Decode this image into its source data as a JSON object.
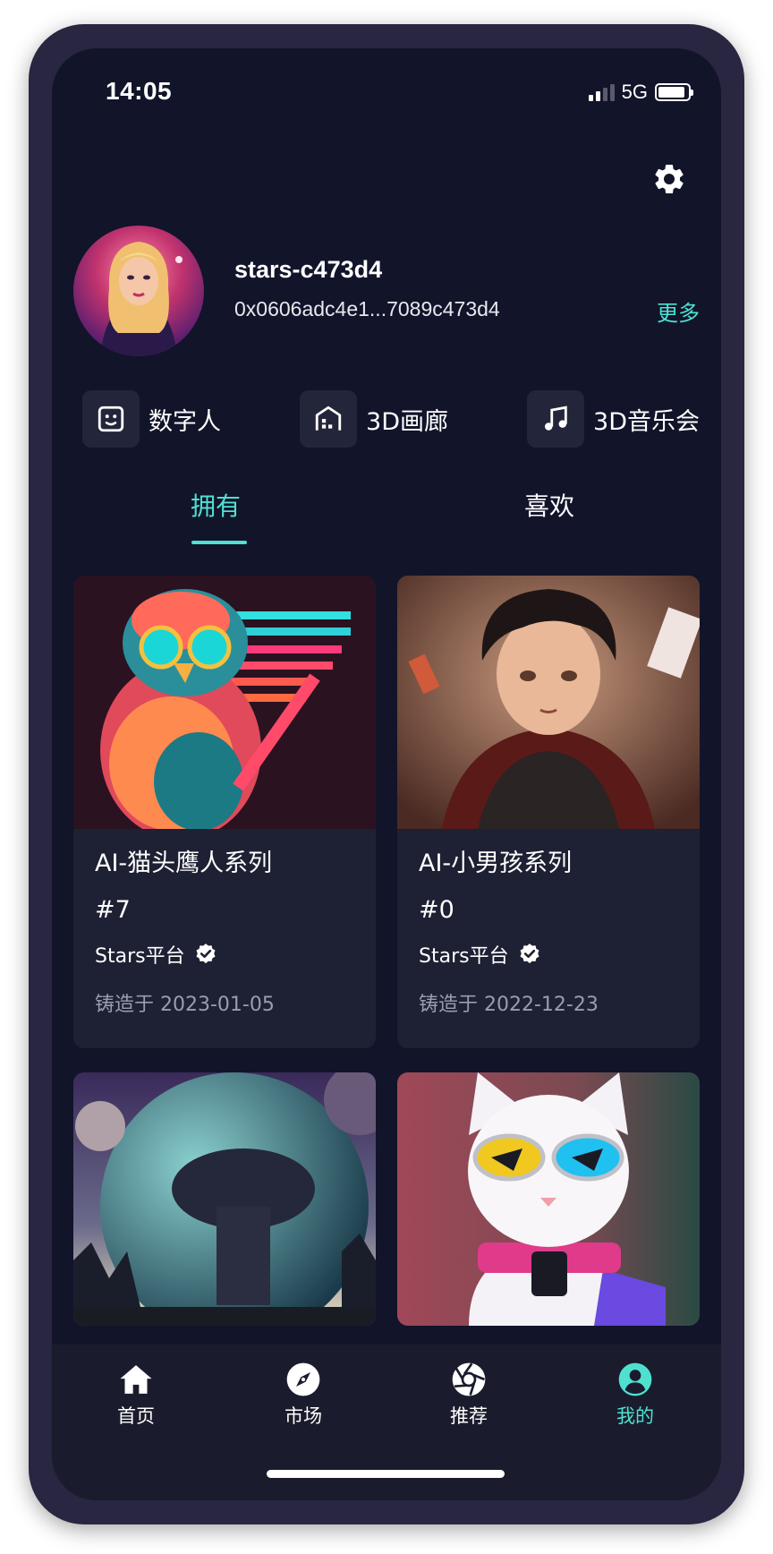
{
  "status_bar": {
    "time": "14:05",
    "network": "5G",
    "signal_bars_active": 2,
    "signal_bars_total": 4,
    "battery_level": 0.9
  },
  "header": {
    "settings_icon": "gear-icon"
  },
  "profile": {
    "username": "stars-c473d4",
    "wallet_address": "0x0606adc4e1...7089c473d4",
    "more_label": "更多"
  },
  "quick_actions": [
    {
      "label": "数字人",
      "icon": "face-icon"
    },
    {
      "label": "3D画廊",
      "icon": "gallery-icon"
    },
    {
      "label": "3D音乐会",
      "icon": "music-note-icon"
    }
  ],
  "tabs": [
    {
      "label": "拥有",
      "active": true
    },
    {
      "label": "喜欢",
      "active": false
    }
  ],
  "cards": [
    {
      "title": "AI-猫头鹰人系列",
      "number": "#7",
      "creator": "Stars平台",
      "date": "铸造于 2023-01-05",
      "image": "owl-warrior-artwork"
    },
    {
      "title": "AI-小男孩系列",
      "number": "#0",
      "creator": "Stars平台",
      "date": "铸造于 2022-12-23",
      "image": "anime-boy-artwork"
    },
    {
      "title": "",
      "number": "",
      "creator": "",
      "date": "",
      "image": "planet-spaceship-artwork"
    },
    {
      "title": "",
      "number": "",
      "creator": "",
      "date": "",
      "image": "cat-sunglasses-artwork"
    }
  ],
  "bottom_nav": [
    {
      "label": "首页",
      "icon": "home-icon",
      "active": false
    },
    {
      "label": "市场",
      "icon": "compass-icon",
      "active": false
    },
    {
      "label": "推荐",
      "icon": "aperture-icon",
      "active": false
    },
    {
      "label": "我的",
      "icon": "user-icon",
      "active": true
    }
  ],
  "colors": {
    "accent": "#4fe1d0",
    "background": "#12142a",
    "card": "#1e2033",
    "frame": "#282640"
  }
}
